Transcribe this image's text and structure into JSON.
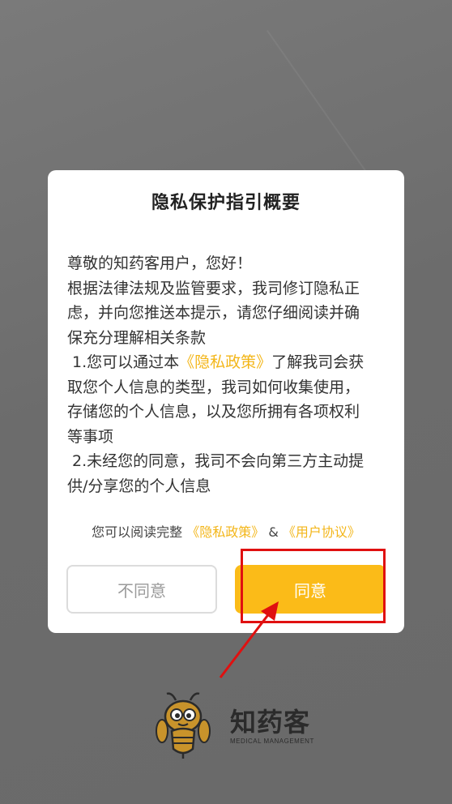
{
  "dialog": {
    "title": "隐私保护指引概要",
    "greeting": "尊敬的知药客用户，您好！",
    "intro_lines": [
      "根据法律法规及监管要求，我司修订隐私正",
      "虑，并向您推送本提示，请您仔细阅读并确",
      "保充分理解相关条款"
    ],
    "item1_prefix": " 1.您可以通过本",
    "item1_link": "《隐私政策》",
    "item1_suffix": "了解我司会获",
    "item1_lines": [
      "取您个人信息的类型，我司如何收集使用，",
      "存储您的个人信息，以及您所拥有各项权利",
      "等事项"
    ],
    "item2_lines": [
      " 2.未经您的同意，我司不会向第三方主动提",
      "供/分享您的个人信息"
    ],
    "footer_prefix": "您可以阅读完整",
    "footer_link_privacy": "《隐私政策》",
    "footer_amp": "&",
    "footer_link_agreement": "《用户协议》",
    "disagree_label": "不同意",
    "agree_label": "同意"
  },
  "logo": {
    "name": "知药客",
    "subtitle": "MEDICAL MANAGEMENT",
    "icon": "bee-mascot-icon"
  },
  "colors": {
    "accent": "#fbbb18",
    "link": "#f3b619",
    "annotation": "#e01010",
    "overlay": "#6e6e6e"
  }
}
